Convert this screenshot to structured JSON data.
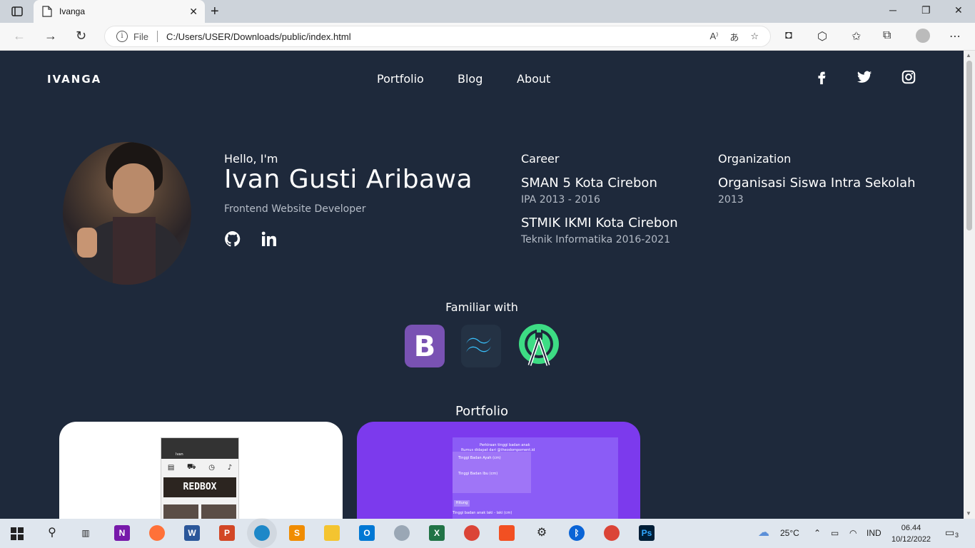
{
  "browser": {
    "tab_title": "Ivanga",
    "file_label": "File",
    "url": "C:/Users/USER/Downloads/public/index.html"
  },
  "site": {
    "brand": "IVANGA",
    "nav": [
      "Portfolio",
      "Blog",
      "About"
    ],
    "social_icons": [
      "facebook-icon",
      "twitter-icon",
      "instagram-icon"
    ]
  },
  "profile": {
    "greeting": "Hello, I'm",
    "name": "Ivan Gusti Aribawa",
    "role": "Frontend Website Developer",
    "links": [
      "github-icon",
      "linkedin-icon"
    ]
  },
  "career": {
    "heading": "Career",
    "items": [
      {
        "title": "SMAN 5 Kota Cirebon",
        "sub": "IPA 2013 - 2016"
      },
      {
        "title": "STMIK IKMI Kota Cirebon",
        "sub": "Teknik Informatika 2016-2021"
      }
    ]
  },
  "organization": {
    "heading": "Organization",
    "items": [
      {
        "title": "Organisasi Siswa Intra Sekolah",
        "sub": "2013"
      }
    ]
  },
  "familiar": {
    "heading": "Familiar with",
    "tech": [
      "bootstrap-icon",
      "tailwind-icon",
      "android-studio-icon"
    ]
  },
  "portfolio": {
    "heading": "Portfolio",
    "card1": {
      "banner": "REDBOX",
      "user": "Ivan",
      "icons": [
        "Booking",
        "Keranjang",
        "Riwayat",
        "Notifikasi"
      ]
    },
    "card2": {
      "line1": "Perkiraan tinggi badan anak",
      "line2": "Rumus didapat dari @theodompoment.id",
      "field1": "Tinggi Badan Ayah (cm)",
      "field2": "Tinggi Badan Ibu (cm)",
      "button": "Hitung",
      "result": "Tinggi badan anak laki - laki (cm)"
    }
  },
  "taskbar": {
    "weather": "25°C",
    "language": "IND",
    "time": "06.44",
    "date": "10/12/2022",
    "notifications": "3"
  },
  "colors": {
    "page_bg": "#1e293b",
    "bootstrap": "#7952b3",
    "tailwind": "#38bdf8",
    "android": "#3ddc84",
    "card2": "#7c3aed"
  }
}
